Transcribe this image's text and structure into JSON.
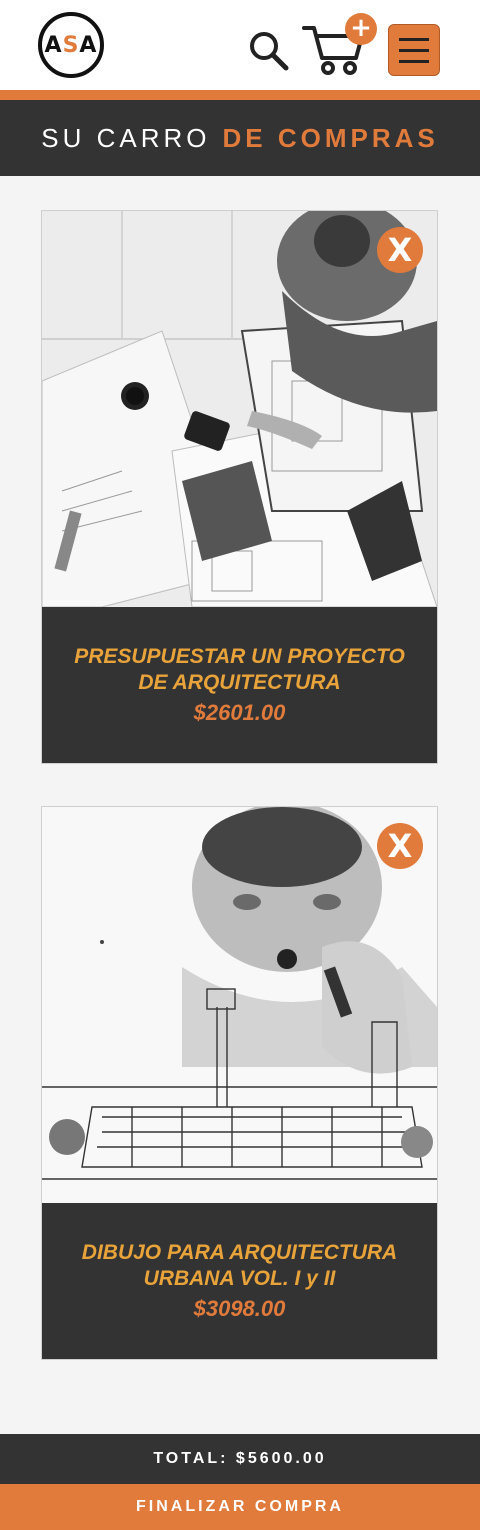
{
  "header": {
    "logo_text": {
      "a1": "A",
      "s": "S",
      "a2": "A"
    },
    "icons": {
      "search": "search-icon",
      "cart": "cart-icon",
      "cart_badge": "+",
      "menu": "hamburger-menu-icon"
    }
  },
  "title": {
    "part1": "SU CARRO",
    "part2": "DE COMPRAS"
  },
  "cart": {
    "items": [
      {
        "name": "PRESUPUESTAR UN PROYECTO DE ARQUITECTURA",
        "price": "$2601.00",
        "remove_label": "X"
      },
      {
        "name": "DIBUJO PARA ARQUITECTURA URBANA VOL. I y II",
        "price": "$3098.00",
        "remove_label": "X"
      }
    ]
  },
  "footer": {
    "total": "TOTAL: $5600.00",
    "checkout_label": "FINALIZAR COMPRA"
  },
  "colors": {
    "accent": "#e07b3c",
    "dark": "#333333",
    "product_name": "#e8a33a"
  }
}
